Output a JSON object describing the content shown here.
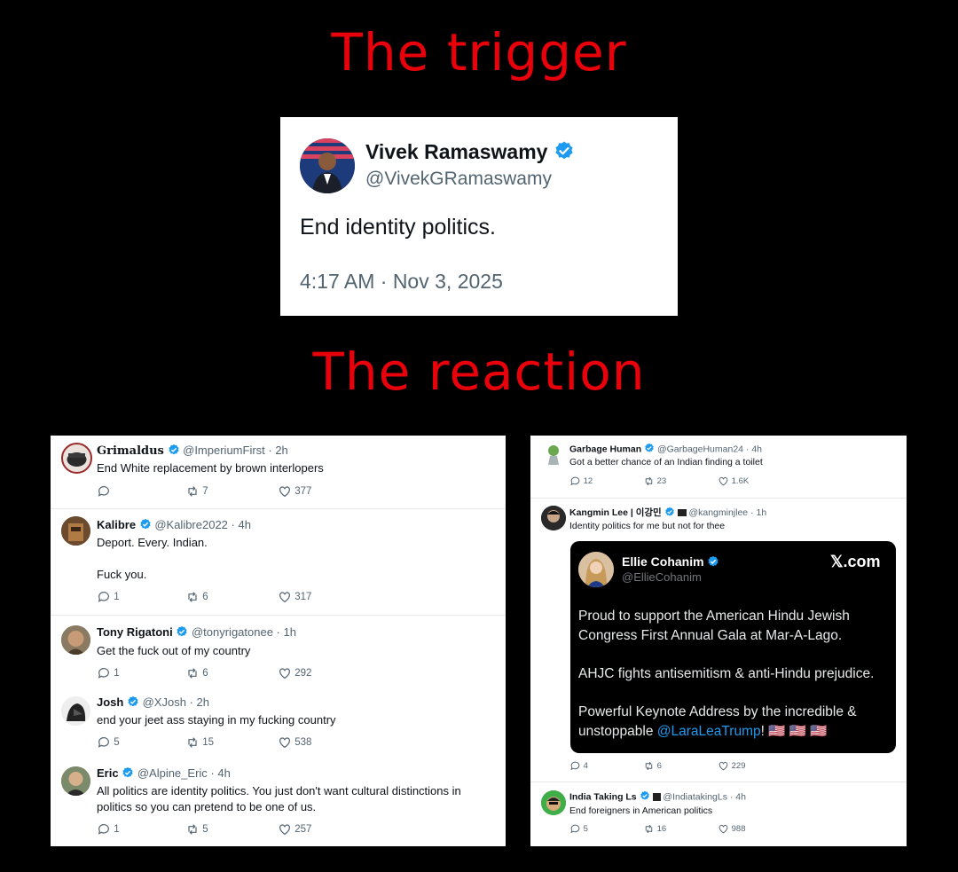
{
  "headings": {
    "trigger": "The trigger",
    "reaction": "The reaction"
  },
  "colors": {
    "heading": "#e8000b",
    "verified": "#1d9bf0",
    "link": "#1d9bf0"
  },
  "main_tweet": {
    "name": "Vivek Ramaswamy",
    "handle": "@VivekGRamaswamy",
    "text": "End identity politics.",
    "timestamp": "4:17 AM · Nov 3, 2025"
  },
  "left_replies": [
    {
      "name": "Grimaldus",
      "meta": "@ImperiumFirst · 2h",
      "text": "End White replacement by brown interlopers",
      "replies": "",
      "reposts": "7",
      "likes": "377"
    },
    {
      "name": "Kalibre",
      "meta": "@Kalibre2022 · 4h",
      "text": "Deport.  Every.  Indian.\n\nFuck you.",
      "replies": "1",
      "reposts": "6",
      "likes": "317"
    },
    {
      "name": "Tony Rigatoni",
      "meta": "@tonyrigatonee · 1h",
      "text": "Get the fuck out of my country",
      "replies": "1",
      "reposts": "6",
      "likes": "292"
    },
    {
      "name": "Josh",
      "meta": "@XJosh · 2h",
      "text": "end your jeet ass staying in my fucking country",
      "replies": "5",
      "reposts": "15",
      "likes": "538"
    },
    {
      "name": "Eric",
      "meta": "@Alpine_Eric · 4h",
      "text": "All politics are identity politics. You just don't want cultural distinctions in politics so you can pretend to be one of us.",
      "replies": "1",
      "reposts": "5",
      "likes": "257"
    }
  ],
  "right_replies": [
    {
      "name": "Garbage Human",
      "meta": "@GarbageHuman24 · 4h",
      "text": "Got a better chance of an Indian finding a toilet",
      "replies": "12",
      "reposts": "23",
      "likes": "1.6K"
    },
    {
      "name": "Kangmin Lee | 이강민",
      "meta": "@kangminjlee · 1h",
      "text": "Identity politics for me but not for thee",
      "replies": "4",
      "reposts": "6",
      "likes": "229"
    },
    {
      "name": "India Taking Ls",
      "meta": "@IndiatakingLs · 4h",
      "text": "End foreigners in American politics",
      "replies": "5",
      "reposts": "16",
      "likes": "988"
    }
  ],
  "embedded_card": {
    "name": "Ellie Cohanim",
    "handle": "@EllieCohanim",
    "brand": "𝕏.com",
    "paragraph1": "Proud to support the American Hindu Jewish Congress First Annual Gala at Mar-A-Lago.",
    "paragraph2": "AHJC fights antisemitism & anti-Hindu prejudice.",
    "paragraph3_prefix": "Powerful Keynote Address by the incredible & unstoppable ",
    "mention": "@LaraLeaTrump",
    "paragraph3_suffix": "! 🇺🇸 🇺🇸 🇺🇸"
  }
}
